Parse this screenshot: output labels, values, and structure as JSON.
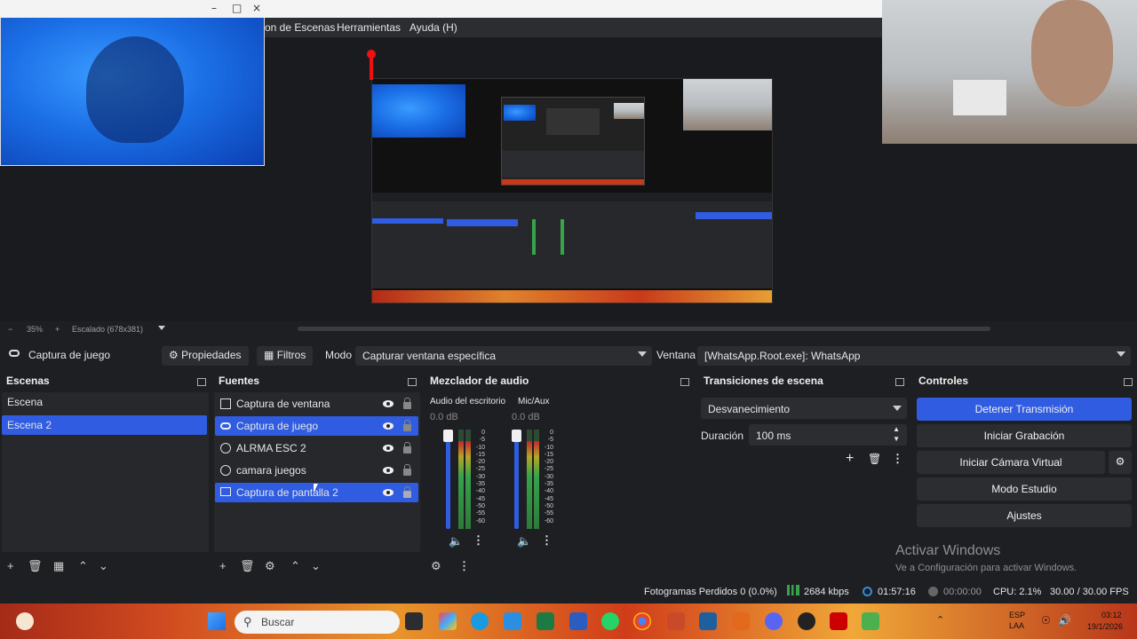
{
  "menu": {
    "items": [
      "on de Escenas",
      "Herramientas",
      "Ayuda (H)"
    ]
  },
  "zoom": {
    "level": "35%",
    "plus": "+",
    "minus": "−",
    "scale_label": "Escalado (678x381)"
  },
  "properties_bar": {
    "source_name": "Captura de juego",
    "properties_label": "Propiedades",
    "filters_label": "Filtros",
    "mode_label": "Modo",
    "mode_value": "Capturar ventana específica",
    "window_label": "Ventana",
    "window_value": "[WhatsApp.Root.exe]: WhatsApp"
  },
  "scenes": {
    "title": "Escenas",
    "items": [
      {
        "label": "Escena",
        "selected": false
      },
      {
        "label": "Escena 2",
        "selected": true
      }
    ]
  },
  "sources": {
    "title": "Fuentes",
    "items": [
      {
        "label": "Captura de ventana",
        "icon": "window-icon",
        "selected": false
      },
      {
        "label": "Captura de juego",
        "icon": "gamepad-icon",
        "selected": true
      },
      {
        "label": "ALRMA ESC 2",
        "icon": "globe-icon",
        "selected": false
      },
      {
        "label": "camara juegos",
        "icon": "globe-icon",
        "selected": false
      },
      {
        "label": "Captura de pantalla 2",
        "icon": "monitor-icon",
        "selected": true
      }
    ]
  },
  "mixer": {
    "title": "Mezclador de audio",
    "channels": [
      {
        "name": "Audio del escritorio",
        "db": "0.0 dB",
        "level": 0.12
      },
      {
        "name": "Mic/Aux",
        "db": "0.0 dB",
        "level": 0.12
      }
    ],
    "scale": [
      "0",
      "-5",
      "-10",
      "-15",
      "-20",
      "-25",
      "-30",
      "-35",
      "-40",
      "-45",
      "-50",
      "-55",
      "-60"
    ]
  },
  "transitions": {
    "title": "Transiciones de escena",
    "type": "Desvanecimiento",
    "duration_label": "Duración",
    "duration_value": "100 ms"
  },
  "controls": {
    "title": "Controles",
    "buttons": [
      "Detener Transmisión",
      "Iniciar Grabación",
      "Iniciar Cámara Virtual",
      "Modo Estudio",
      "Ajustes"
    ]
  },
  "watermark": {
    "line1": "Activar Windows",
    "line2": "Ve a Configuración para activar Windows."
  },
  "status": {
    "dropped": "Fotogramas Perdidos 0 (0.0%)",
    "bitrate": "2684 kbps",
    "stream_time": "01:57:16",
    "rec_time": "00:00:00",
    "cpu": "CPU: 2.1%",
    "fps": "30.00 / 30.00 FPS"
  },
  "taskbar": {
    "search_placeholder": "Buscar",
    "lang": "ESP",
    "lang2": "LAA",
    "time": "03:12",
    "date": "19/1/2026"
  },
  "colors": {
    "accent": "#2f5ce0",
    "panel": "#26282c",
    "bg": "#1e1f22"
  }
}
